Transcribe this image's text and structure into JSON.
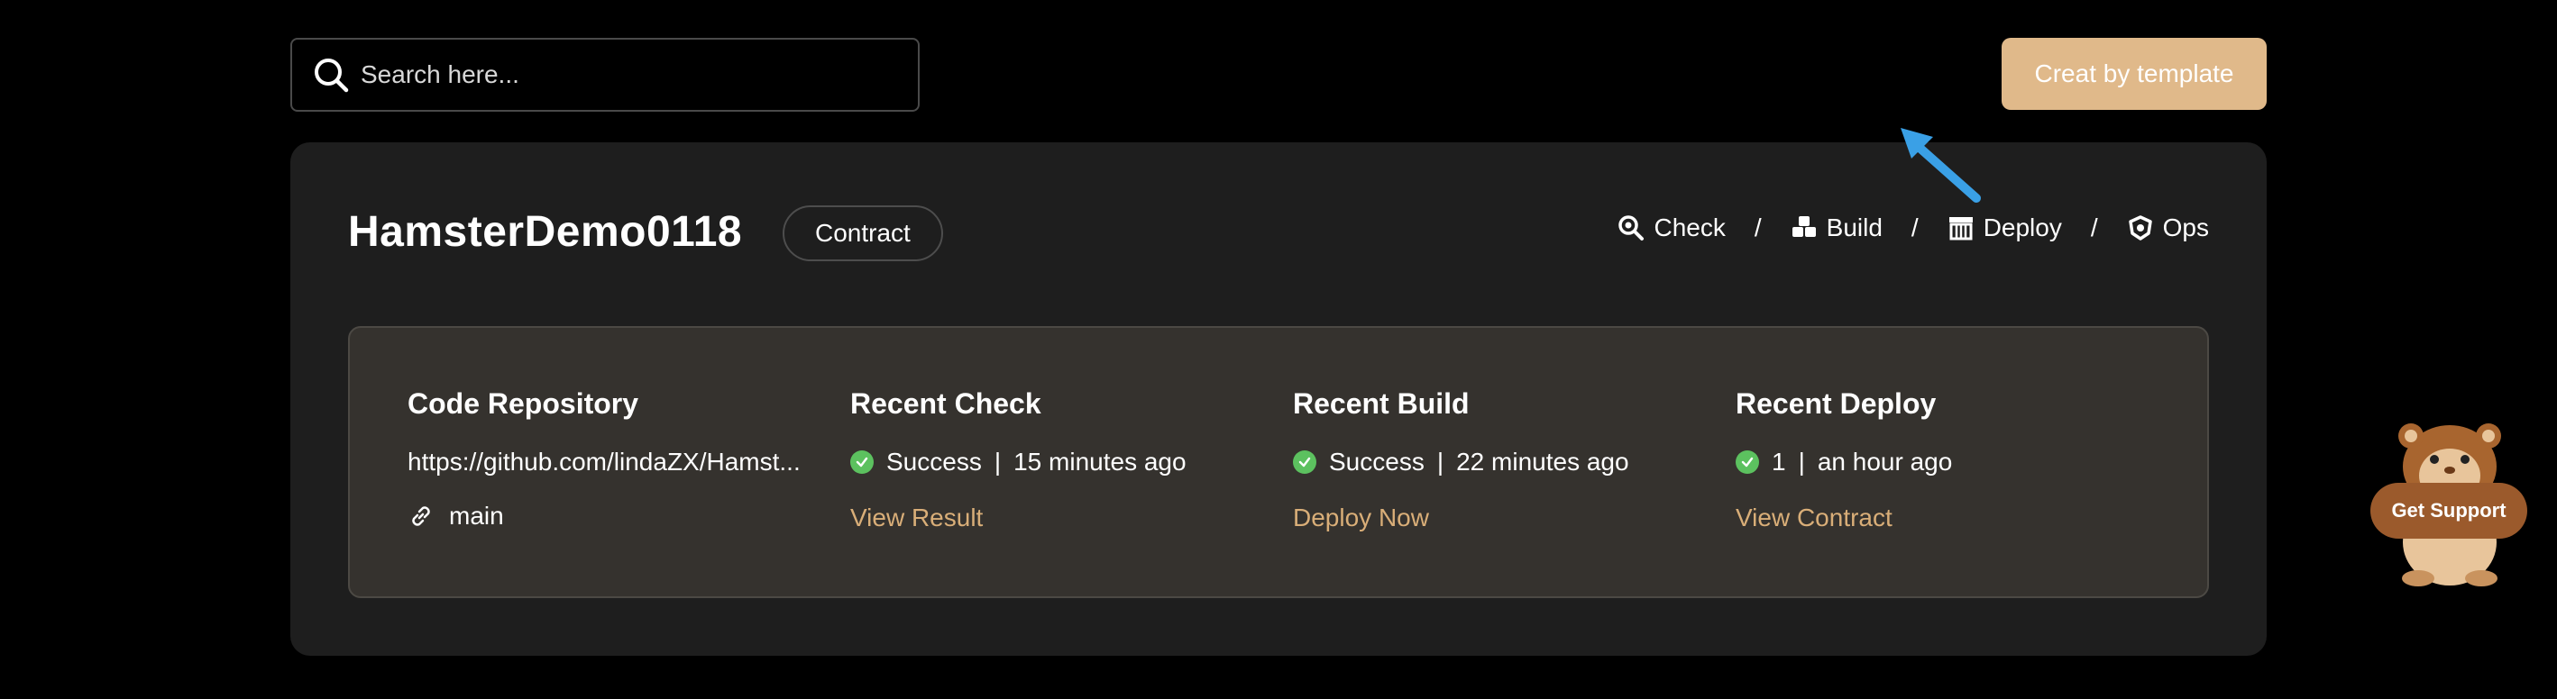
{
  "search": {
    "placeholder": "Search here..."
  },
  "header": {
    "template_button_label": "Creat by template"
  },
  "project": {
    "name": "HamsterDemo0118",
    "type_tag": "Contract",
    "stages": [
      {
        "label": "Check",
        "icon": "search-icon"
      },
      {
        "label": "Build",
        "icon": "cubes-icon"
      },
      {
        "label": "Deploy",
        "icon": "archive-icon"
      },
      {
        "label": "Ops",
        "icon": "shield-icon"
      }
    ],
    "separator": "/"
  },
  "summary": {
    "code_repository": {
      "title": "Code Repository",
      "url": "https://github.com/lindaZX/Hamst...",
      "branch": "main"
    },
    "recent_check": {
      "title": "Recent Check",
      "status": "Success",
      "time": "15 minutes ago",
      "link": "View Result"
    },
    "recent_build": {
      "title": "Recent Build",
      "status": "Success",
      "time": "22 minutes ago",
      "link": "Deploy Now"
    },
    "recent_deploy": {
      "title": "Recent Deploy",
      "status": "1",
      "time": "an hour ago",
      "link": "View Contract"
    },
    "divider": "|"
  },
  "support": {
    "label": "Get Support"
  },
  "colors": {
    "accent": "#e0b98a",
    "link": "#d9ae78",
    "success": "#5cc15f",
    "card_bg": "#1e1e1e",
    "panel_bg": "#35322e",
    "annotation_arrow": "#3aa0e6"
  }
}
